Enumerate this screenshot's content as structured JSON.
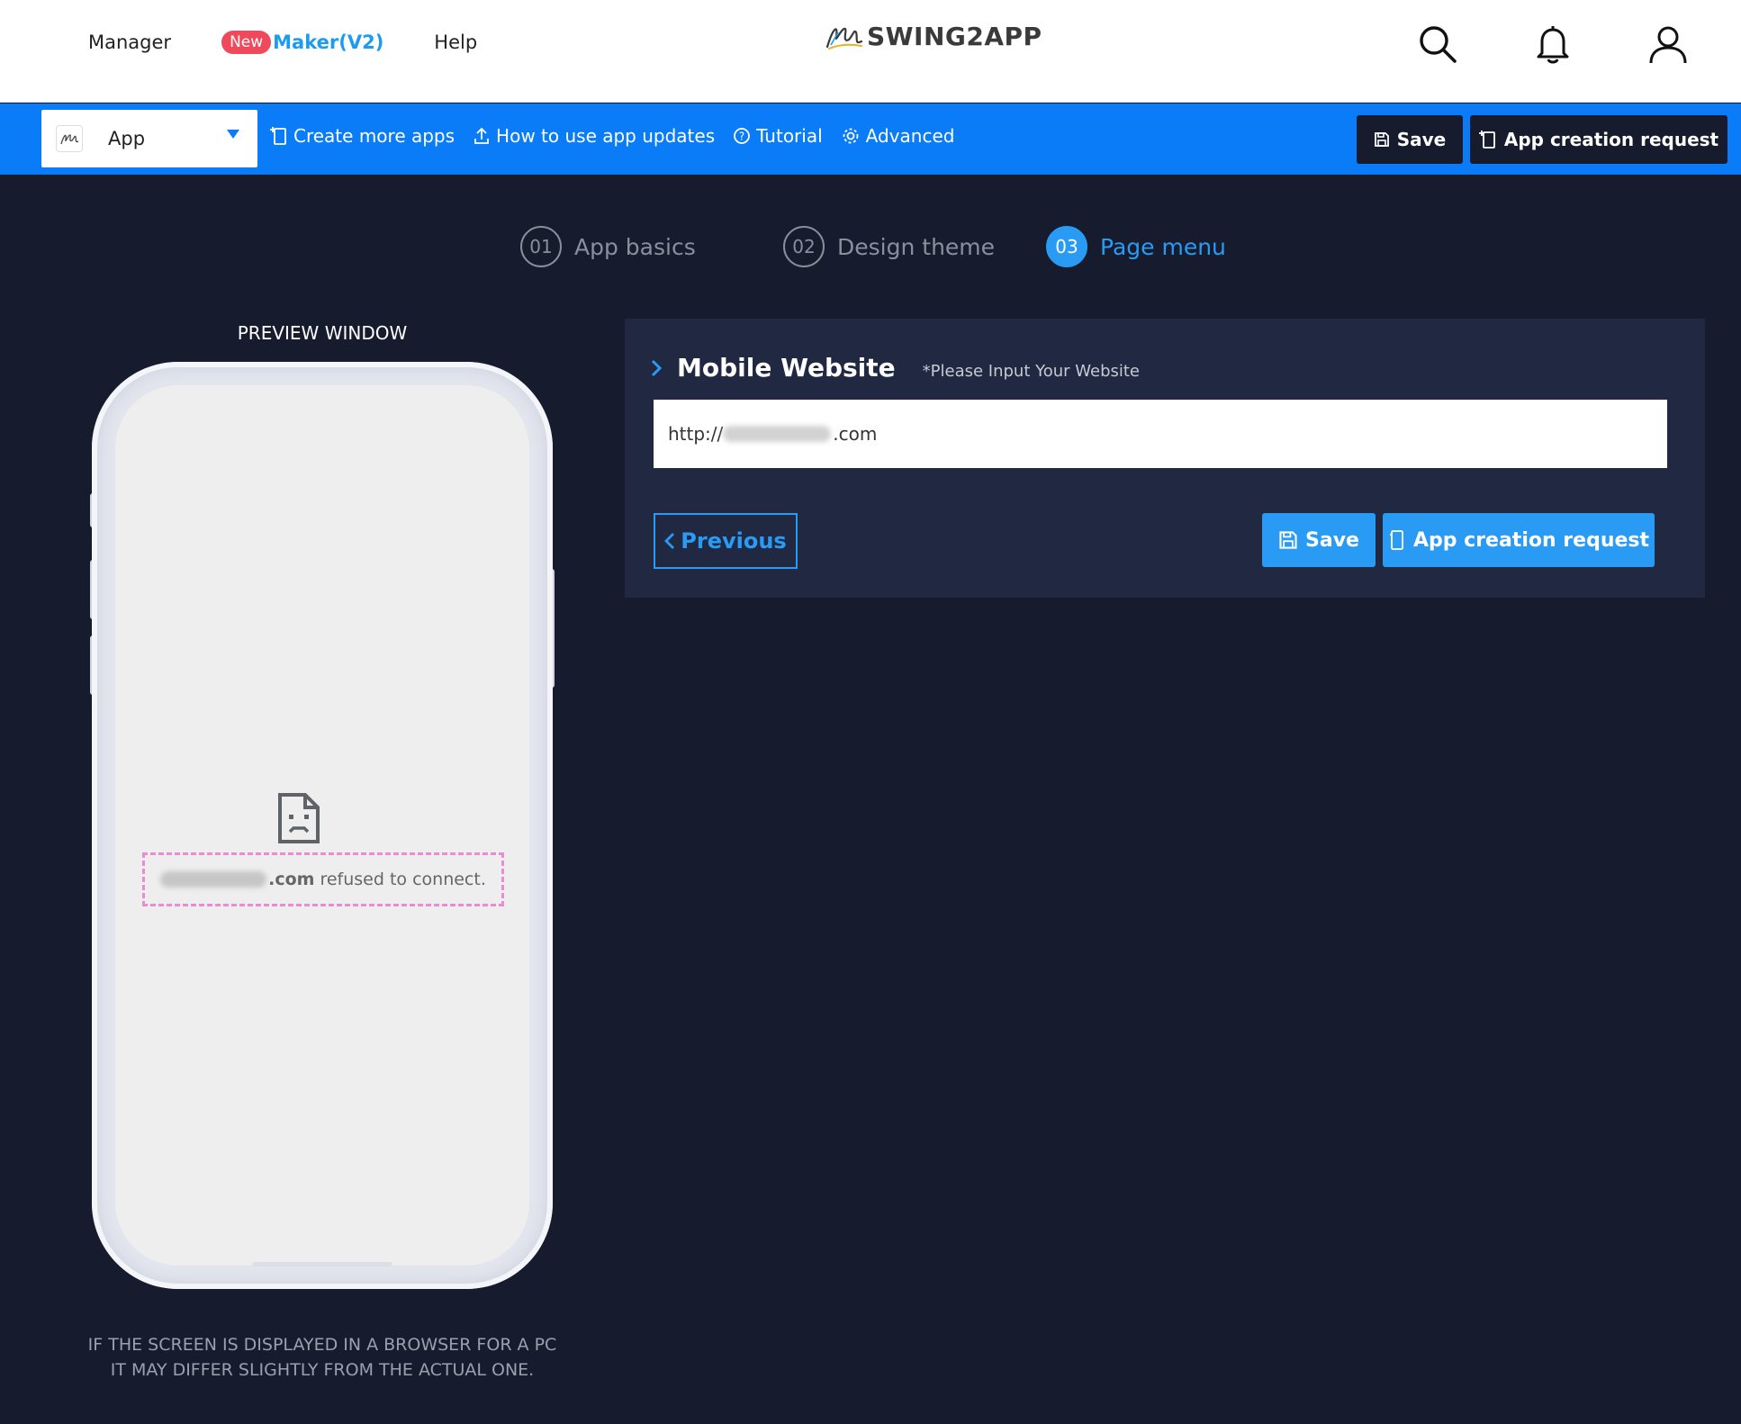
{
  "header": {
    "nav": {
      "manager": "Manager",
      "new_badge": "New",
      "maker": "Maker(V2)",
      "help": "Help"
    },
    "logo_text": "SWING2APP",
    "icons": [
      "search-icon",
      "bell-icon",
      "user-icon"
    ]
  },
  "toolbar": {
    "app_select": "App",
    "links": {
      "create_more": "Create more apps",
      "how_to_update": "How to use app updates",
      "tutorial": "Tutorial",
      "advanced": "Advanced"
    },
    "save": "Save",
    "app_creation_request": "App creation request"
  },
  "steps": [
    {
      "num": "01",
      "label": "App basics",
      "active": false
    },
    {
      "num": "02",
      "label": "Design theme",
      "active": false
    },
    {
      "num": "03",
      "label": "Page menu",
      "active": true
    }
  ],
  "preview": {
    "title": "PREVIEW WINDOW",
    "refused_domain_suffix": ".com",
    "refused_text": "refused to connect.",
    "note_line1": "IF THE SCREEN IS DISPLAYED IN A BROWSER FOR A PC",
    "note_line2": "IT MAY DIFFER SLIGHTLY FROM THE ACTUAL ONE."
  },
  "panel": {
    "title": "Mobile Website",
    "hint": "*Please Input Your Website",
    "url_prefix": "http://",
    "url_suffix": ".com",
    "previous": "Previous",
    "save": "Save",
    "app_creation_request": "App creation request"
  },
  "colors": {
    "background": "#161b2e",
    "toolbar_blue": "#0a7cf7",
    "accent_blue": "#2a9bf5",
    "panel": "#202842",
    "new_badge": "#ef4a5b",
    "dashed_highlight": "#ec8bd4"
  }
}
